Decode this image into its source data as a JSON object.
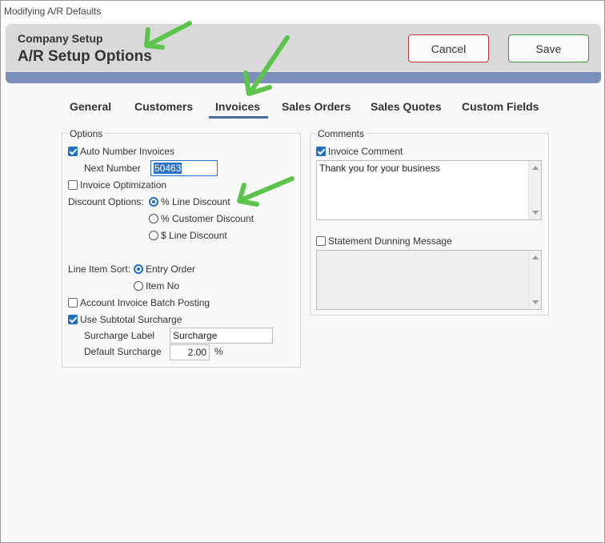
{
  "window": {
    "title": "Modifying A/R Defaults"
  },
  "header": {
    "subtitle": "Company Setup",
    "title": "A/R Setup Options",
    "cancel_label": "Cancel",
    "save_label": "Save"
  },
  "tabs": [
    {
      "label": "General"
    },
    {
      "label": "Customers"
    },
    {
      "label": "Invoices",
      "active": true
    },
    {
      "label": "Sales Orders"
    },
    {
      "label": "Sales Quotes"
    },
    {
      "label": "Custom Fields"
    }
  ],
  "options": {
    "legend": "Options",
    "auto_number_label": "Auto Number Invoices",
    "next_number_label": "Next Number",
    "next_number_value": "50463",
    "invoice_optimization_label": "Invoice Optimization",
    "discount_options_label": "Discount Options:",
    "discount_pct_line": "% Line Discount",
    "discount_pct_customer": "% Customer Discount",
    "discount_dollar_line": "$ Line Discount",
    "line_item_sort_label": "Line Item Sort:",
    "sort_entry_order": "Entry Order",
    "sort_item_no": "Item No",
    "batch_posting_label": "Account Invoice Batch Posting",
    "subtotal_surcharge_label": "Use Subtotal Surcharge",
    "surcharge_label_label": "Surcharge Label",
    "surcharge_label_value": "Surcharge",
    "default_surcharge_label": "Default Surcharge",
    "default_surcharge_value": "2.00",
    "percent_sign": "%"
  },
  "comments": {
    "legend": "Comments",
    "invoice_comment_label": "Invoice Comment",
    "invoice_comment_text": "Thank you for your business",
    "dunning_label": "Statement Dunning Message",
    "dunning_text": ""
  },
  "colors": {
    "accent": "#1f6fc5",
    "header_bar": "#7b8fba",
    "cancel_border": "#c0393a",
    "save_border": "#3a9b3a",
    "annotation_arrow": "#5cc44a"
  }
}
